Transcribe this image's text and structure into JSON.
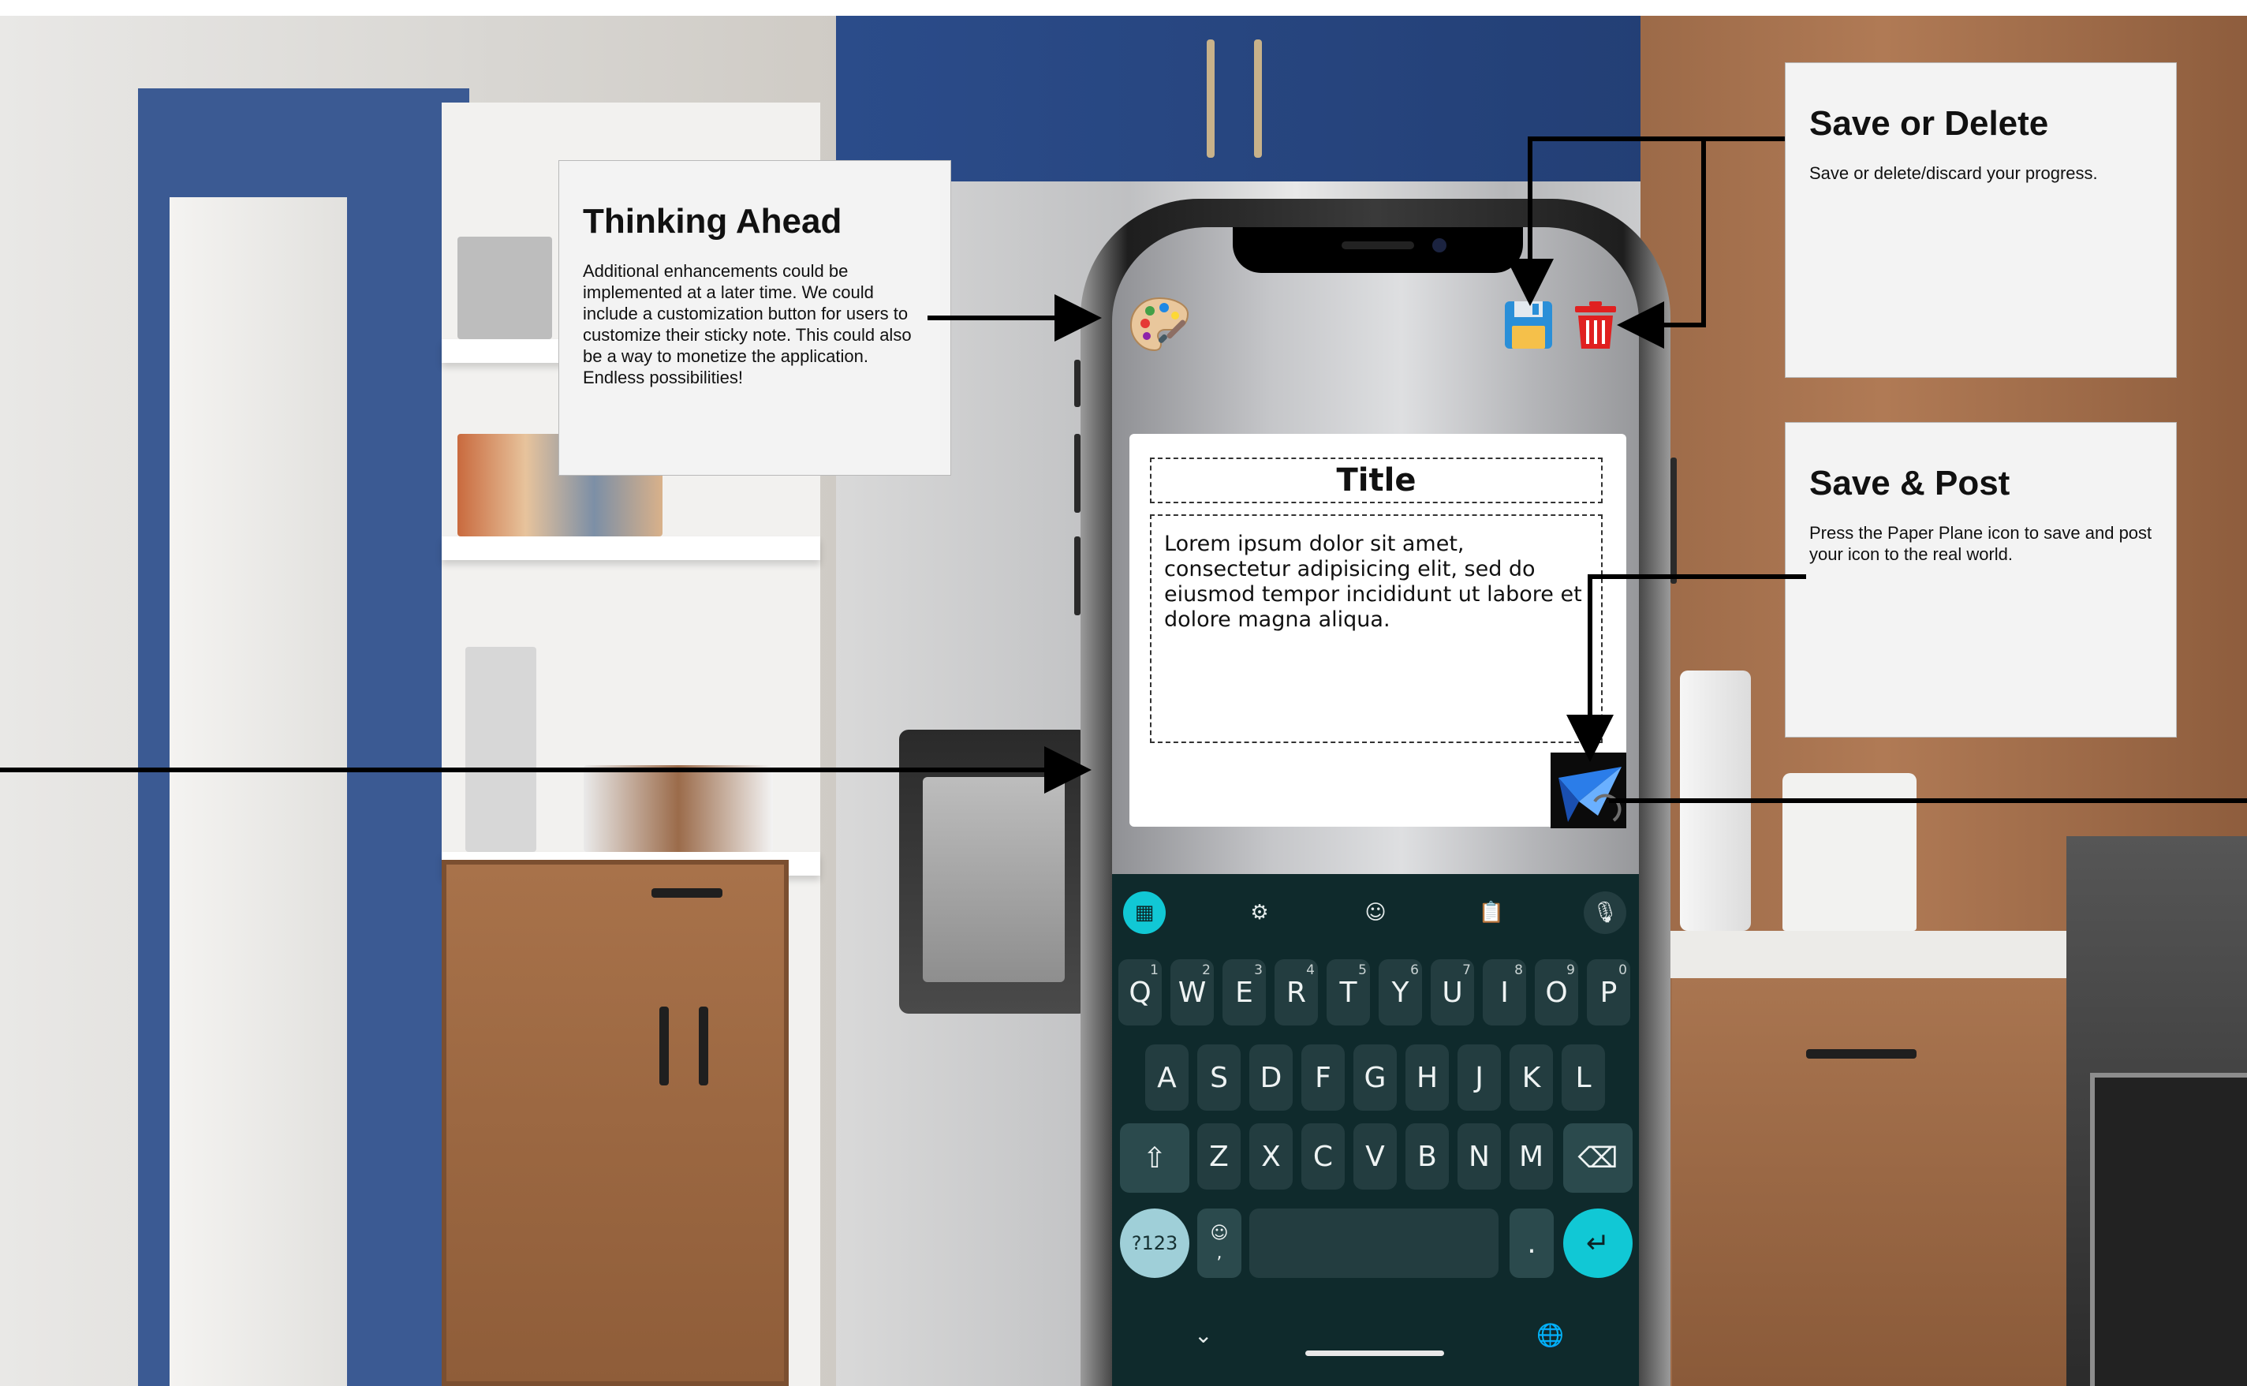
{
  "callouts": {
    "thinking_ahead": {
      "title": "Thinking Ahead",
      "body": "Additional enhancements could be implemented at a later time. We could include a customization button for users to customize their sticky note. This could also be a way to monetize the application. Endless possibilities!"
    },
    "save_or_delete": {
      "title": "Save or Delete",
      "body": "Save or delete/discard your progress."
    },
    "save_and_post": {
      "title": "Save & Post",
      "body": "Press the Paper Plane icon to save and post your icon to the real world."
    }
  },
  "top_icons": {
    "palette": "palette-icon",
    "save": "floppy-disk-icon",
    "delete": "trash-icon"
  },
  "note": {
    "title": "Title",
    "body": "Lorem ipsum dolor sit amet, consectetur adipisicing elit, sed do eiusmod tempor incididunt ut labore et dolore magna aliqua.",
    "send_icon": "paper-plane-icon"
  },
  "keyboard": {
    "toolbar": [
      "apps-grid-icon",
      "settings-gear-icon",
      "emoji-icon",
      "clipboard-icon",
      "microphone-icon"
    ],
    "row1": [
      {
        "label": "Q",
        "hint": "1"
      },
      {
        "label": "W",
        "hint": "2"
      },
      {
        "label": "E",
        "hint": "3"
      },
      {
        "label": "R",
        "hint": "4"
      },
      {
        "label": "T",
        "hint": "5"
      },
      {
        "label": "Y",
        "hint": "6"
      },
      {
        "label": "U",
        "hint": "7"
      },
      {
        "label": "I",
        "hint": "8"
      },
      {
        "label": "O",
        "hint": "9"
      },
      {
        "label": "P",
        "hint": "0"
      }
    ],
    "row2": [
      "A",
      "S",
      "D",
      "F",
      "G",
      "H",
      "J",
      "K",
      "L"
    ],
    "row3": [
      "Z",
      "X",
      "C",
      "V",
      "B",
      "N",
      "M"
    ],
    "symbols_label": "?123",
    "comma_label": ",",
    "emoji_small": "☺",
    "period_label": ".",
    "enter_glyph": "↵",
    "shift_glyph": "⇧",
    "backspace_glyph": "⌫",
    "collapse_glyph": "⌄",
    "globe_glyph": "🌐"
  },
  "colors": {
    "keyboard_bg": "#0f2a2c",
    "key_bg": "#233d40",
    "accent_teal": "#11c8d5",
    "trash_red": "#e02020",
    "save_blue": "#2a8fd8",
    "send_blue": "#2b7de9"
  }
}
